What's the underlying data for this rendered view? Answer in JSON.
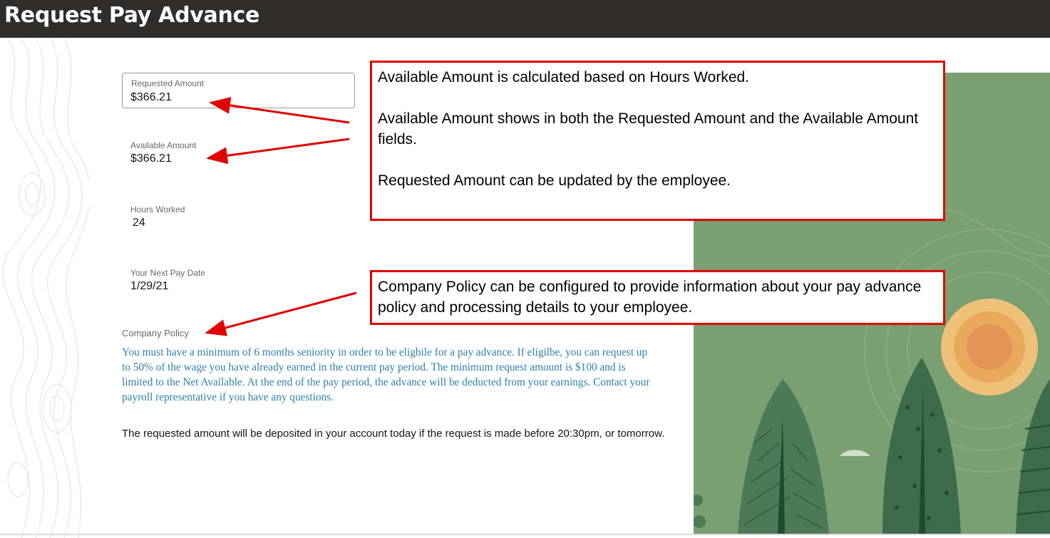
{
  "header": {
    "title": "Request Pay Advance"
  },
  "form": {
    "requested_amount": {
      "label": "Requested Amount",
      "value": "$366.21"
    },
    "available_amount": {
      "label": "Available Amount",
      "value": "$366.21"
    },
    "hours_worked": {
      "label": "Hours Worked",
      "value": "24"
    },
    "next_pay_date": {
      "label": "Your Next Pay Date",
      "value": "1/29/21"
    },
    "company_policy": {
      "label": "Company Policy",
      "text": "You must have a minimum of 6 months seniority in order to be eligbile for a pay advance. If eligilbe, you can request up to 50% of the wage you have already earned in the current pay period. The minimum request amount is $100 and is limited to the Net Available. At the end of the pay period, the advance will be deducted from your earnings. Contact your payroll representative if you have any questions."
    },
    "deposit_note": "The requested amount will be deposited in your account today if the request is made before 20:30pm, or tomorrow."
  },
  "annotations": {
    "callout_1": [
      "Available Amount is calculated based on Hours Worked.",
      "Available Amount shows in both the Requested Amount and the Available Amount fields.",
      "Requested Amount can be updated by the employee."
    ],
    "callout_2": "Company Policy can be configured to provide information about your pay advance policy and processing details to your employee."
  },
  "colors": {
    "header_bg": "#312d2a",
    "policy_text": "#2f7fa8",
    "annotation_border": "#e00000",
    "illustration_bg": "#7a9f72"
  },
  "icons": [
    "topographic-pattern",
    "forest-illustration",
    "annotation-arrow"
  ]
}
